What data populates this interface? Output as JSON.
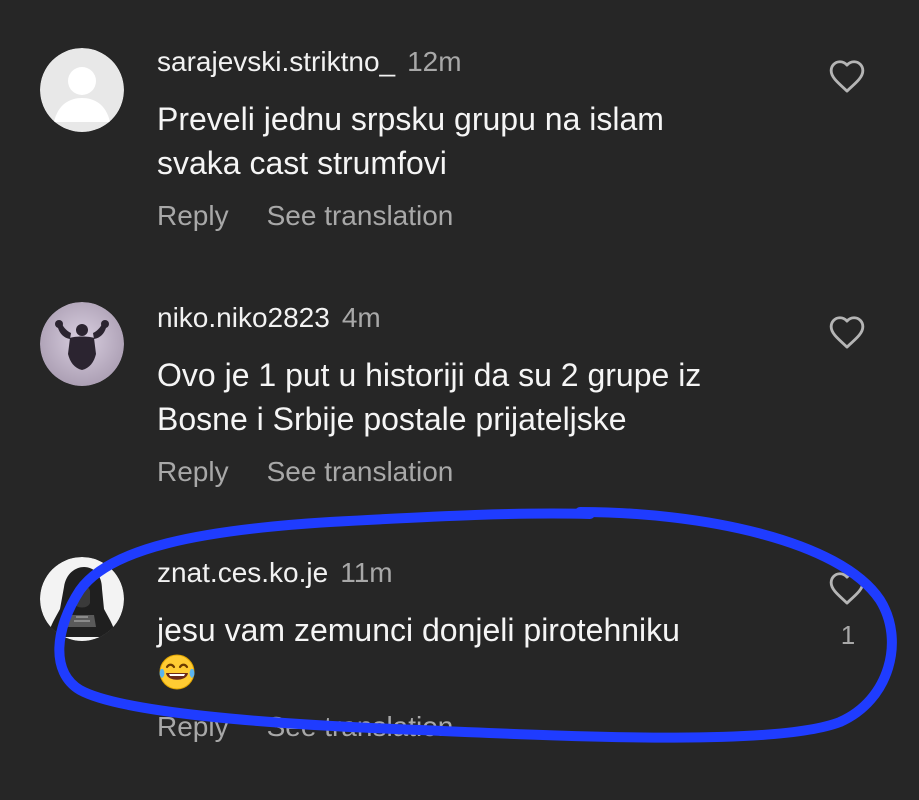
{
  "comments": [
    {
      "username": "sarajevski.striktno_",
      "time": "12m",
      "text_line1": "Preveli jednu srpsku grupu na islam",
      "text_line2": "svaka cast strumfovi",
      "reply_label": "Reply",
      "translate_label": "See translation",
      "avatar": "default-avatar-icon"
    },
    {
      "username": "niko.niko2823",
      "time": "4m",
      "text_line1": "Ovo je 1 put u historiji da su 2 grupe iz",
      "text_line2": "Bosne i Srbije postale prijateljske",
      "reply_label": "Reply",
      "translate_label": "See translation",
      "avatar": "bodybuilder-silhouette-avatar"
    },
    {
      "username": "znat.ces.ko.je",
      "time": "11m",
      "text_line1": "jesu vam zemunci donjeli pirotehniku",
      "emoji": "face-with-tears-of-joy-emoji",
      "reply_label": "Reply",
      "translate_label": "See translation",
      "like_count": "1",
      "avatar": "hooded-figure-avatar"
    }
  ],
  "colors": {
    "background": "#262626",
    "primary_text": "#f5f5f5",
    "secondary_text": "#a8a8a8",
    "annotation_stroke": "#1f3cff"
  },
  "icons": {
    "like": "heart-outline-icon"
  }
}
